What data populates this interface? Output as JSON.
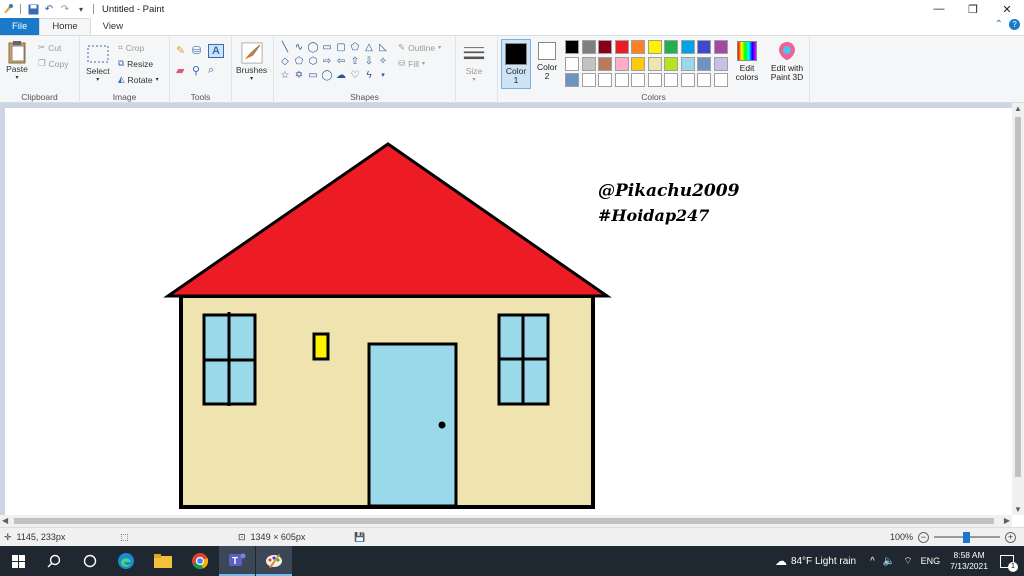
{
  "window": {
    "title": "Untitled - Paint",
    "minimize": "—",
    "restore": "❐",
    "close": "✕"
  },
  "tabs": [
    {
      "label": "File"
    },
    {
      "label": "Home"
    },
    {
      "label": "View"
    }
  ],
  "ribbon": {
    "clipboard": {
      "label": "Clipboard",
      "paste": "Paste",
      "cut": "Cut",
      "copy": "Copy"
    },
    "image": {
      "label": "Image",
      "select": "Select",
      "crop": "Crop",
      "resize": "Resize",
      "rotate": "Rotate"
    },
    "tools": {
      "label": "Tools"
    },
    "brushes": {
      "label": "Brushes"
    },
    "shapes": {
      "label": "Shapes",
      "outline": "Outline",
      "fill": "Fill"
    },
    "size": {
      "label": "Size"
    },
    "colors": {
      "label": "Colors",
      "color1": "Color 1",
      "color2": "Color 2",
      "edit_colors": "Edit colors",
      "edit_paint3d": "Edit with Paint 3D",
      "palette_row1": [
        "#000000",
        "#7f7f7f",
        "#880015",
        "#ed1c24",
        "#ff7f27",
        "#fff200",
        "#22b14c",
        "#00a2e8",
        "#3f48cc",
        "#a349a4"
      ],
      "palette_row2": [
        "#ffffff",
        "#c3c3c3",
        "#b97a57",
        "#ffaec9",
        "#ffc90e",
        "#efe4b0",
        "#b5e61d",
        "#99d9ea",
        "#7092be",
        "#c8bfe7"
      ],
      "palette_row3": [
        "#7092be",
        "#ffffff",
        "#ffffff",
        "#ffffff",
        "#ffffff",
        "#ffffff",
        "#ffffff",
        "#ffffff",
        "#ffffff",
        "#ffffff"
      ]
    }
  },
  "drawing": {
    "text_line1": "@Pikachu2009",
    "text_line2": "#Hoidap247",
    "roof_color": "#ed1c24",
    "wall_color": "#efe4b0",
    "glass_color": "#99d9ea",
    "small_window_color": "#fff200",
    "outline_color": "#000000"
  },
  "status": {
    "cursor_pos": "1145, 233px",
    "canvas_size": "1349 × 605px",
    "zoom": "100%"
  },
  "taskbar": {
    "weather": "84°F  Light rain",
    "lang": "ENG",
    "time": "8:58 AM",
    "date": "7/13/2021",
    "notifications": "1"
  }
}
